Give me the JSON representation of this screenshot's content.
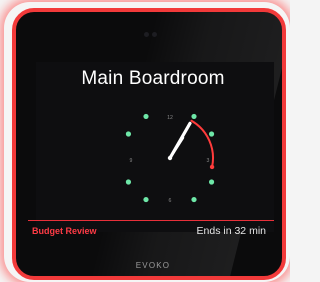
{
  "room": {
    "name": "Main Boardroom"
  },
  "clock": {
    "marks": {
      "top": "12",
      "right": "3",
      "left": "9",
      "bottom": "6"
    },
    "time": {
      "hour": 1,
      "minute": 5
    },
    "booked_arc_minutes": [
      5,
      17
    ],
    "dot_color": "#6ee7a8",
    "hand_color": "#ffffff",
    "accent_color": "#ff3b3b"
  },
  "status": {
    "meeting_title": "Budget Review",
    "ends_text": "Ends in 32 min"
  },
  "brand": {
    "name": "EVOKO"
  },
  "colors": {
    "frame": "#f23a3a",
    "background": "#0b0b0c"
  }
}
